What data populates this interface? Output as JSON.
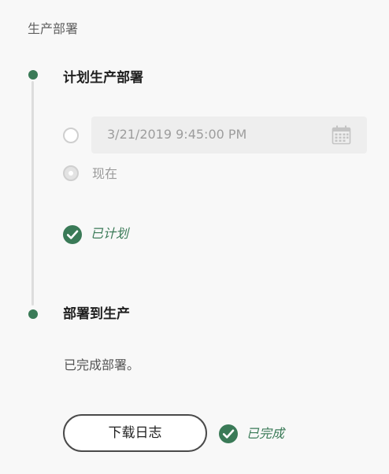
{
  "header": {
    "title": "生产部署"
  },
  "timeline": {
    "schedule_step": {
      "title": "计划生产部署",
      "schedule_input": {
        "value": "3/21/2019  9:45:00 PM",
        "icon": "calendar-icon"
      },
      "now_option": {
        "label": "现在",
        "selected": true
      },
      "status": {
        "icon": "check-circle-icon",
        "text": "已计划"
      }
    },
    "deploy_step": {
      "title": "部署到生产",
      "description": "已完成部署。",
      "log_button_label": "下载日志",
      "status": {
        "icon": "check-circle-icon",
        "text": "已完成"
      }
    }
  },
  "colors": {
    "accent_green": "#3a7a57",
    "timeline_line": "#dddddd",
    "input_background": "#eeeeee",
    "page_background": "#f8f8f8"
  }
}
